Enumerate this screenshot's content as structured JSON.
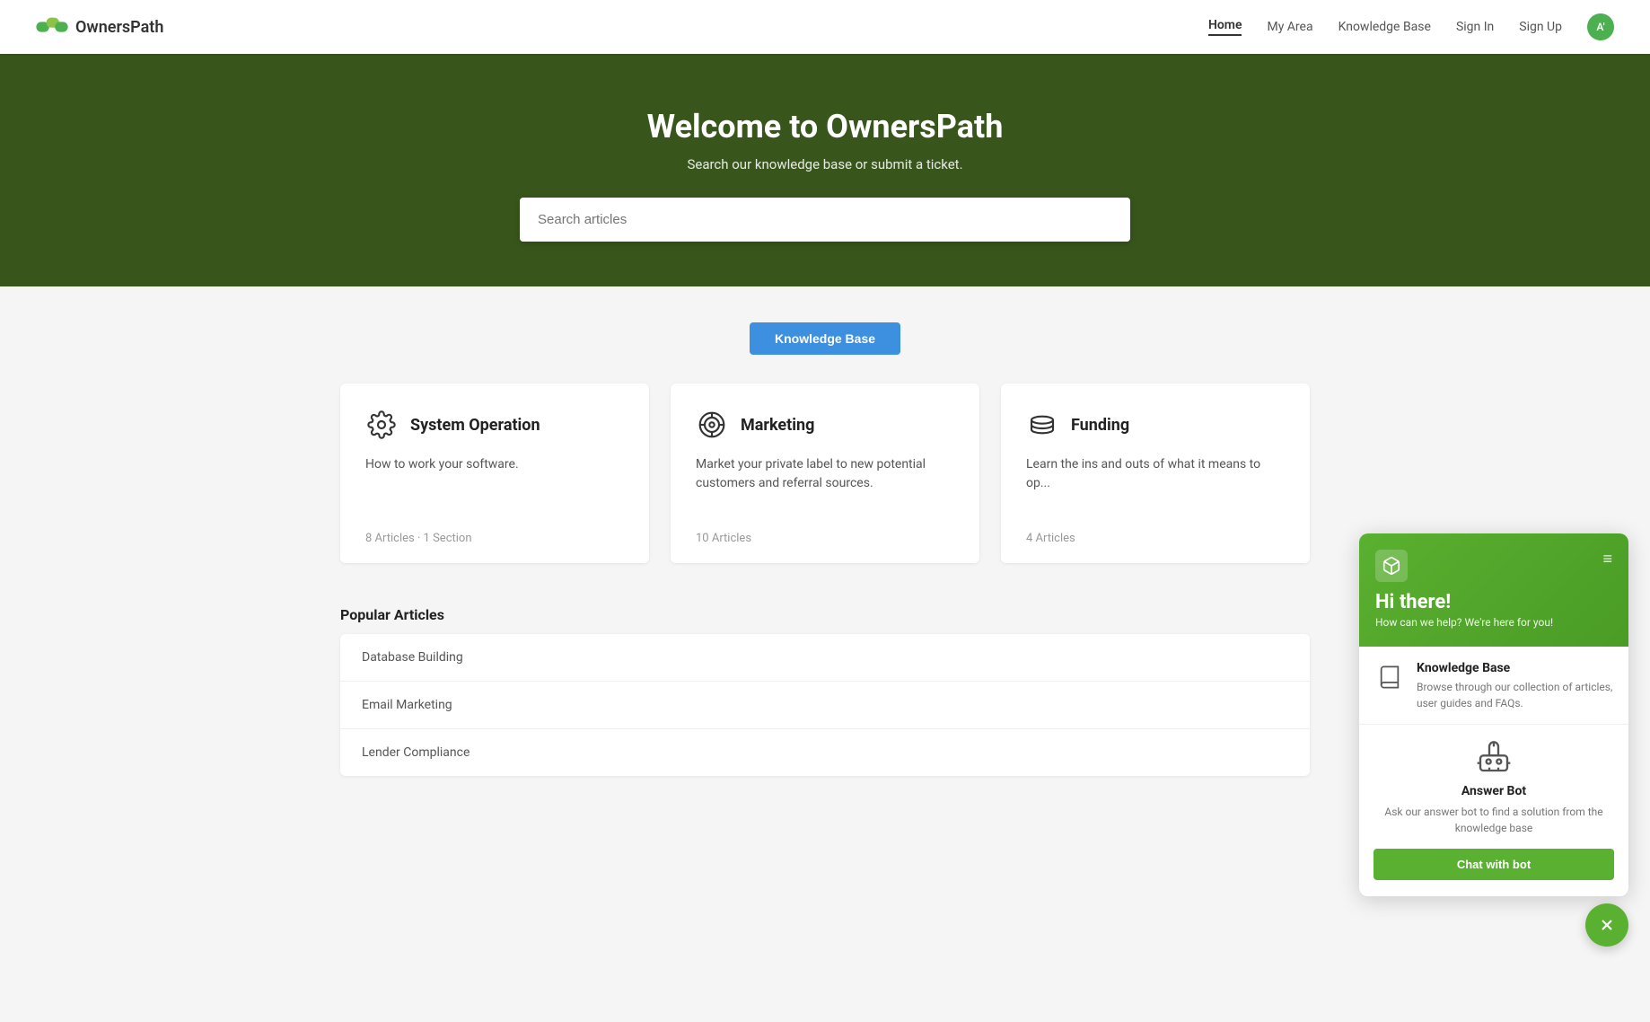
{
  "navbar": {
    "brand": "OwnersPath",
    "links": [
      {
        "label": "Home",
        "active": true
      },
      {
        "label": "My Area",
        "active": false
      },
      {
        "label": "Knowledge Base",
        "active": false
      },
      {
        "label": "Sign In",
        "active": false
      },
      {
        "label": "Sign Up",
        "active": false
      }
    ],
    "avatar_initials": "A'"
  },
  "hero": {
    "title": "Welcome to OwnersPath",
    "subtitle": "Search our knowledge base or submit a ticket.",
    "search_placeholder": "Search articles"
  },
  "tabs": [
    {
      "label": "Knowledge Base",
      "active": true
    }
  ],
  "cards": [
    {
      "id": "system-operation",
      "title": "System Operation",
      "description": "How to work your software.",
      "meta": "8 Articles  ·  1 Section",
      "icon": "gear"
    },
    {
      "id": "marketing",
      "title": "Marketing",
      "description": "Market your private label to new potential customers and referral sources.",
      "meta": "10 Articles",
      "icon": "target"
    },
    {
      "id": "funding",
      "title": "Funding",
      "description": "Learn the ins and outs of what it means to op...",
      "meta": "4 Articles",
      "icon": "money"
    }
  ],
  "popular": {
    "title": "Popular Articles",
    "items": [
      {
        "label": "Database Building"
      },
      {
        "label": "Email Marketing"
      },
      {
        "label": "Lender Compliance"
      }
    ]
  },
  "chat_widget": {
    "header_greeting": "Hi there!",
    "header_tagline": "How can we help? We're here for you!",
    "knowledge_base": {
      "title": "Knowledge Base",
      "description": "Browse through our collection of articles, user guides and FAQs."
    },
    "answer_bot": {
      "title": "Answer Bot",
      "description": "Ask our answer bot to find a solution from the knowledge base",
      "cta_label": "Chat with bot"
    },
    "close_icon": "×"
  }
}
